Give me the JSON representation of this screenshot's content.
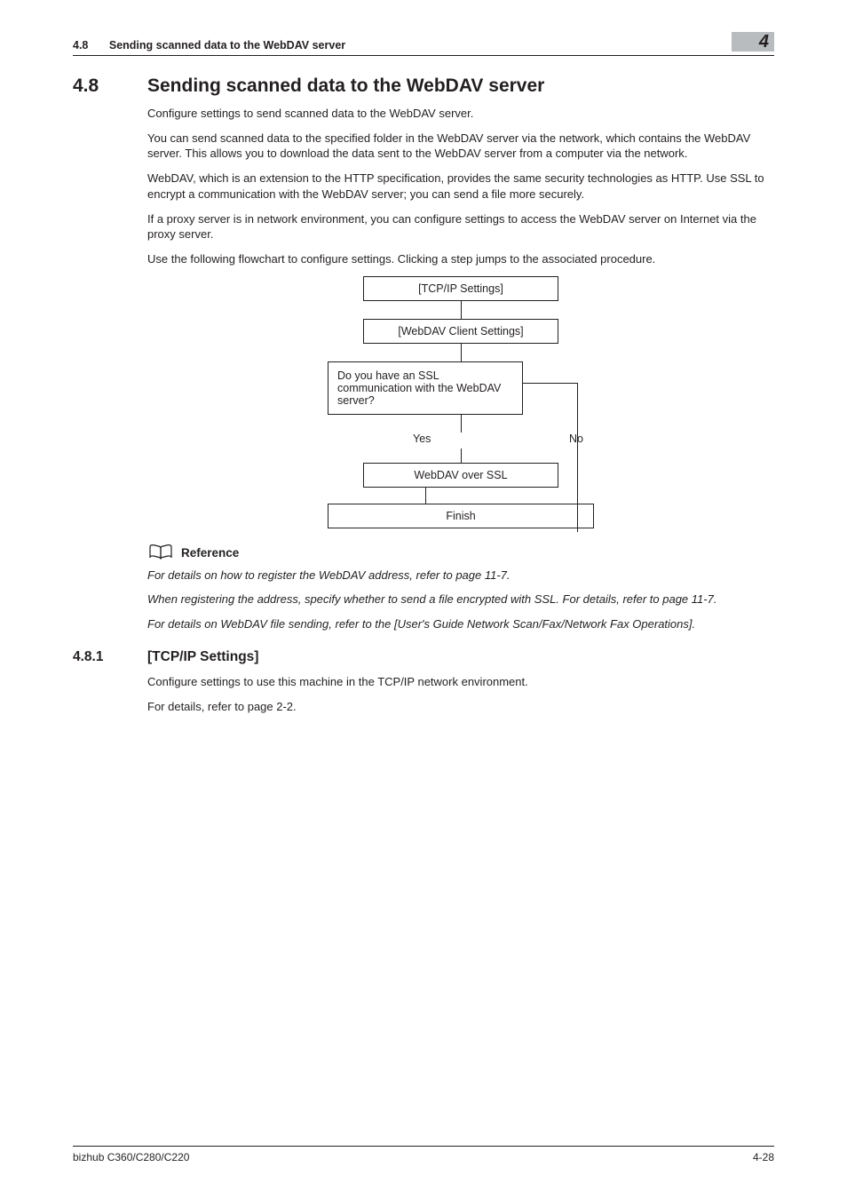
{
  "runhead": {
    "section_num": "4.8",
    "section_title": "Sending scanned data to the WebDAV server",
    "chapter": "4"
  },
  "h1": {
    "num": "4.8",
    "title": "Sending scanned data to the WebDAV server"
  },
  "paras": {
    "p1": "Configure settings to send scanned data to the WebDAV server.",
    "p2": "You can send scanned data to the specified folder in the WebDAV server via the network, which contains the WebDAV server. This allows you to download the data sent to the WebDAV server from a computer via the network.",
    "p3": "WebDAV, which is an extension to the HTTP specification, provides the same security technologies as HTTP. Use SSL to encrypt a communication with the WebDAV server; you can send a file more securely.",
    "p4": "If a proxy server is in network environment, you can configure settings to access the WebDAV server on Internet via the proxy server.",
    "p5": "Use the following flowchart to configure settings. Clicking a step jumps to the associated procedure."
  },
  "flow": {
    "step1": "[TCP/IP Settings]",
    "step2": "[WebDAV Client Settings]",
    "decision": "Do you have an SSL communication with the WebDAV server?",
    "yes": "Yes",
    "no": "No",
    "step3": "WebDAV over SSL",
    "finish": "Finish"
  },
  "reference": {
    "label": "Reference",
    "r1": "For details on how to register the WebDAV address, refer to page 11-7.",
    "r2": "When registering the address, specify whether to send a file encrypted with SSL. For details, refer to page 11-7.",
    "r3": "For details on WebDAV file sending, refer to the [User's Guide Network Scan/Fax/Network Fax Operations]."
  },
  "h2": {
    "num": "4.8.1",
    "title": "[TCP/IP Settings]"
  },
  "sub_paras": {
    "s1": "Configure settings to use this machine in the TCP/IP network environment.",
    "s2": "For details, refer to page 2-2."
  },
  "footer": {
    "left": "bizhub C360/C280/C220",
    "right": "4-28"
  }
}
